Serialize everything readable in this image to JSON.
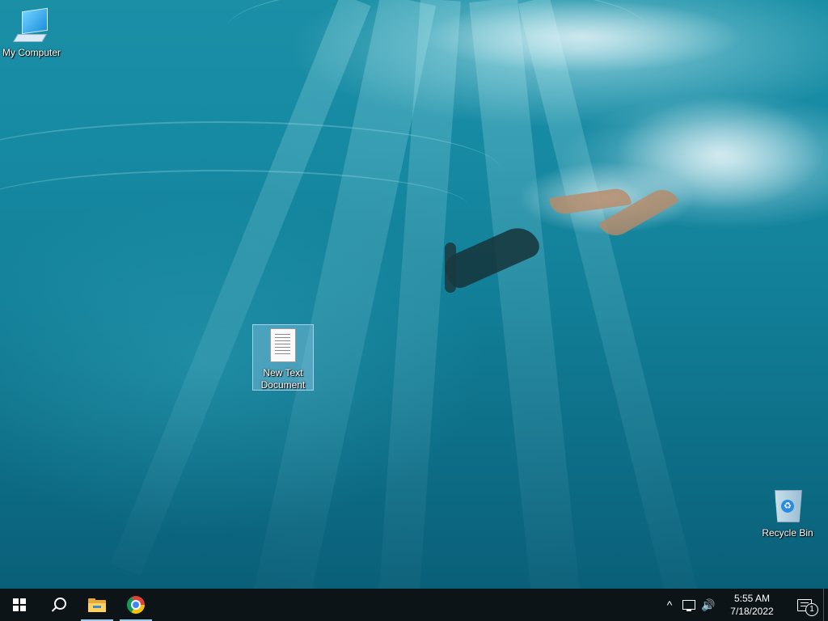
{
  "desktop": {
    "icons": [
      {
        "label": "My Computer",
        "icon": "monitor-icon"
      },
      {
        "label": "New Text\nDocument",
        "icon": "text-document-icon",
        "selected": true
      },
      {
        "label": "Recycle Bin",
        "icon": "recycle-bin-icon"
      }
    ]
  },
  "taskbar": {
    "start_icon": "windows-logo-icon",
    "search_icon": "search-icon",
    "apps": [
      {
        "name_icon": "file-explorer-icon",
        "active": true
      },
      {
        "name_icon": "chrome-icon",
        "active": true
      }
    ],
    "tray": {
      "chevron": "^",
      "volume_glyph": "🔊",
      "time": "5:55 AM",
      "date": "7/18/2022",
      "notification_count": "1"
    }
  },
  "colors": {
    "taskbar": "#0d1418",
    "water_top": "#1a8fa6",
    "water_bottom": "#0a5f78"
  }
}
